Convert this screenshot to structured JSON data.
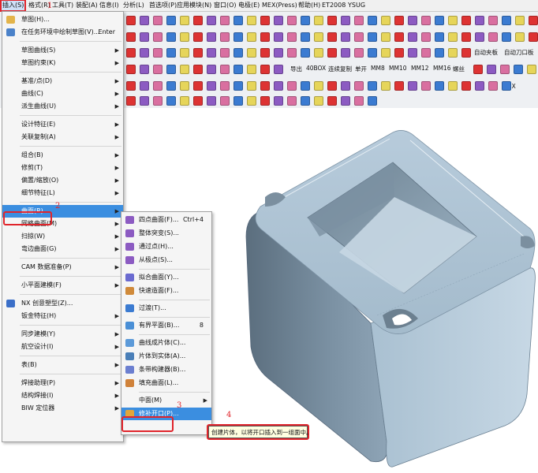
{
  "menubar": {
    "items": [
      "插入(S)",
      "格式(R)",
      "工具(T)",
      "装配(A)",
      "信息(I)",
      "分析(L)",
      "首选项(P)",
      "应用模块(N)",
      "窗口(O)",
      "电极(E)",
      "MEX(Press)",
      "帮助(H)",
      "ET2008",
      "YSUG"
    ]
  },
  "toolbar": {
    "row3_text": [
      "自动夹板",
      "自动刀口板"
    ],
    "row4_text": [
      "导出",
      "40BOX",
      "连续复制",
      "单开",
      "MM8",
      "MM10",
      "MM12",
      "MM16",
      "螺丝"
    ],
    "row5_text": [
      "NX"
    ],
    "shortcut_text": "Enter"
  },
  "insert_menu": {
    "items": [
      {
        "label": "草图(H)...",
        "arrow": false
      },
      {
        "label": "在任务环境中绘制草图(V)...",
        "shortcut": "Enter"
      },
      {
        "label": "草图曲线(S)",
        "arrow": true
      },
      {
        "label": "草图约束(K)",
        "arrow": true
      },
      {
        "label": "基准/点(D)",
        "arrow": true
      },
      {
        "label": "曲线(C)",
        "arrow": true
      },
      {
        "label": "派生曲线(U)",
        "arrow": true
      },
      {
        "label": "设计特征(E)",
        "arrow": true
      },
      {
        "label": "关联复制(A)",
        "arrow": true
      },
      {
        "label": "组合(B)",
        "arrow": true
      },
      {
        "label": "修剪(T)",
        "arrow": true
      },
      {
        "label": "偏置/缩放(O)",
        "arrow": true
      },
      {
        "label": "细节特征(L)",
        "arrow": true
      },
      {
        "label": "曲面(R)",
        "arrow": true
      },
      {
        "label": "网格曲面(M)",
        "arrow": true
      },
      {
        "label": "扫掠(W)",
        "arrow": true
      },
      {
        "label": "弯边曲面(G)",
        "arrow": true
      },
      {
        "label": "CAM 数据准备(P)",
        "arrow": true
      },
      {
        "label": "小平面建模(F)",
        "arrow": true
      },
      {
        "label": "NX 创意塑型(Z)...",
        "arrow": false
      },
      {
        "label": "钣金特征(H)",
        "arrow": true
      },
      {
        "label": "同步建模(Y)",
        "arrow": true
      },
      {
        "label": "航空设计(I)",
        "arrow": true
      },
      {
        "label": "表(B)",
        "arrow": true
      },
      {
        "label": "焊接助理(P)",
        "arrow": true
      },
      {
        "label": "结构焊接(I)",
        "arrow": true
      },
      {
        "label": "BIW 定位器",
        "arrow": true
      }
    ]
  },
  "surface_submenu": {
    "items": [
      {
        "label": "四点曲面(F)...",
        "shortcut": "Ctrl+4"
      },
      {
        "label": "整体突变(S)...",
        "shortcut": ""
      },
      {
        "label": "通过点(H)...",
        "shortcut": ""
      },
      {
        "label": "从极点(S)...",
        "shortcut": ""
      },
      {
        "label": "拟合曲面(Y)...",
        "shortcut": ""
      },
      {
        "label": "快速造面(F)...",
        "shortcut": ""
      },
      {
        "label": "过渡(T)...",
        "shortcut": ""
      },
      {
        "label": "有界平面(B)...",
        "shortcut": "8"
      },
      {
        "label": "曲线成片体(C)...",
        "shortcut": ""
      },
      {
        "label": "片体到实体(A)...",
        "shortcut": ""
      },
      {
        "label": "条带构建器(B)...",
        "shortcut": ""
      },
      {
        "label": "填充曲面(L)...",
        "shortcut": ""
      },
      {
        "label": "中面(M)",
        "shortcut": ""
      },
      {
        "label": "修补开口(P)...",
        "shortcut": ""
      }
    ]
  },
  "tooltip": "创建片体，以将开口插入到一组面中。",
  "annotations": [
    "1",
    "2",
    "3",
    "4"
  ]
}
